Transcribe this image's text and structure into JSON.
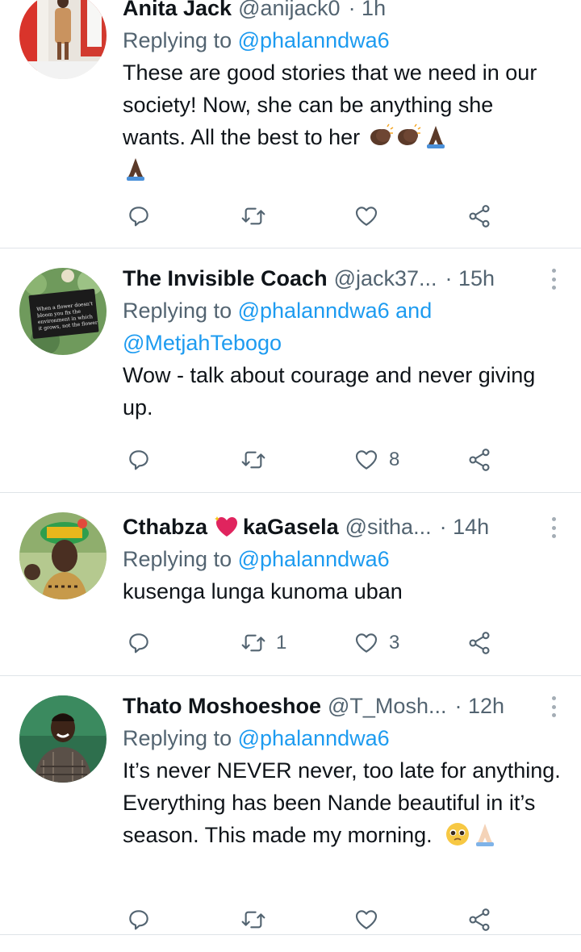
{
  "tweets": [
    {
      "name": "Anita Jack",
      "handle": "@anijack0",
      "time": "· 1h",
      "replying_label": "Replying to",
      "mentions": "@phalanndwa6",
      "text": "These are good stories that we need in our society! Now, she can be anything she wants. All the best to her",
      "emojis": [
        "clapping-hands",
        "clapping-hands",
        "folded-hands",
        "folded-hands"
      ],
      "reply_count": "",
      "retweet_count": "",
      "like_count": ""
    },
    {
      "name": "The Invisible Coach",
      "handle": "@jack37...",
      "time": "· 15h",
      "replying_label": "Replying to",
      "mentions": "@phalanndwa6 and",
      "mentions2": "@MetjahTebogo",
      "avatar_text": "When a flower doesn't bloom you fix the environment in which it grows, not the flower",
      "text": "Wow - talk about courage and never giving up.",
      "reply_count": "",
      "retweet_count": "",
      "like_count": "8"
    },
    {
      "name": "Cthabza",
      "name_suffix": "kaGasela",
      "handle": "@sitha...",
      "time": "· 14h",
      "replying_label": "Replying to",
      "mentions": "@phalanndwa6",
      "text": "kusenga lunga kunoma uban",
      "reply_count": "",
      "retweet_count": "1",
      "like_count": "3"
    },
    {
      "name": "Thato Moshoeshoe",
      "handle": "@T_Mosh...",
      "time": "· 12h",
      "replying_label": "Replying to",
      "mentions": "@phalanndwa6",
      "text": "It’s never NEVER never, too late for anything. Everything has been Nande beautiful in it’s season. This made my morning.",
      "emojis": [
        "pleading-face",
        "folded-hands-light"
      ],
      "reply_count": "",
      "retweet_count": "",
      "like_count": ""
    }
  ],
  "colors": {
    "accent": "#1d9bf0",
    "secondary_text": "#536471",
    "divider": "#dfe4e8",
    "heart_emoji": "#e0245e"
  },
  "icons": [
    "reply-icon",
    "retweet-icon",
    "like-icon",
    "share-icon",
    "more-icon"
  ]
}
